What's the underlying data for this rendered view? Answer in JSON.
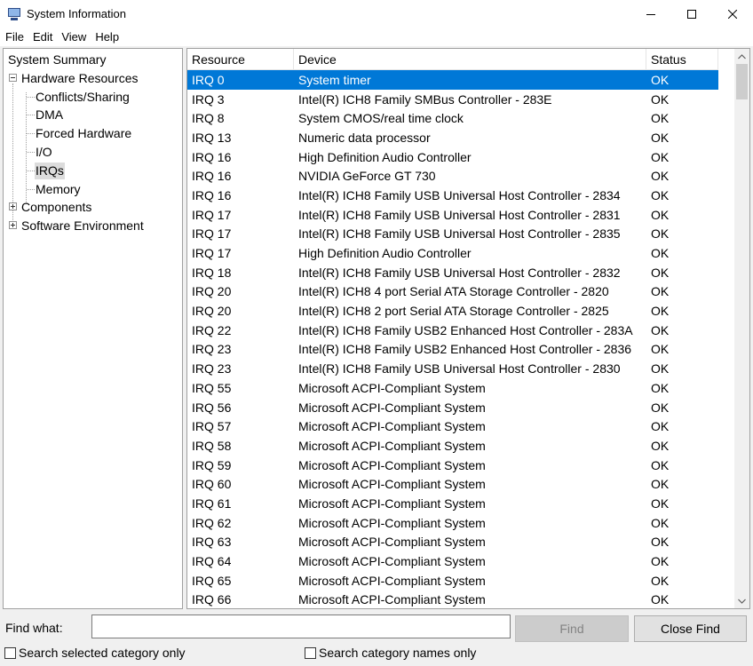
{
  "window": {
    "title": "System Information"
  },
  "menu": [
    "File",
    "Edit",
    "View",
    "Help"
  ],
  "tree": {
    "summary": "System Summary",
    "hardware": "Hardware Resources",
    "hardware_children": [
      "Conflicts/Sharing",
      "DMA",
      "Forced Hardware",
      "I/O",
      "IRQs",
      "Memory"
    ],
    "components": "Components",
    "software": "Software Environment",
    "selected": "IRQs"
  },
  "table": {
    "columns": [
      "Resource",
      "Device",
      "Status"
    ],
    "rows": [
      [
        "IRQ 0",
        "System timer",
        "OK"
      ],
      [
        "IRQ 3",
        "Intel(R) ICH8 Family SMBus Controller - 283E",
        "OK"
      ],
      [
        "IRQ 8",
        "System CMOS/real time clock",
        "OK"
      ],
      [
        "IRQ 13",
        "Numeric data processor",
        "OK"
      ],
      [
        "IRQ 16",
        "High Definition Audio Controller",
        "OK"
      ],
      [
        "IRQ 16",
        "NVIDIA GeForce GT 730",
        "OK"
      ],
      [
        "IRQ 16",
        "Intel(R) ICH8 Family USB Universal Host Controller - 2834",
        "OK"
      ],
      [
        "IRQ 17",
        "Intel(R) ICH8 Family USB Universal Host Controller - 2831",
        "OK"
      ],
      [
        "IRQ 17",
        "Intel(R) ICH8 Family USB Universal Host Controller - 2835",
        "OK"
      ],
      [
        "IRQ 17",
        "High Definition Audio Controller",
        "OK"
      ],
      [
        "IRQ 18",
        "Intel(R) ICH8 Family USB Universal Host Controller - 2832",
        "OK"
      ],
      [
        "IRQ 20",
        "Intel(R) ICH8 4 port Serial ATA Storage Controller - 2820",
        "OK"
      ],
      [
        "IRQ 20",
        "Intel(R) ICH8 2 port Serial ATA Storage Controller - 2825",
        "OK"
      ],
      [
        "IRQ 22",
        "Intel(R) ICH8 Family USB2 Enhanced Host Controller - 283A",
        "OK"
      ],
      [
        "IRQ 23",
        "Intel(R) ICH8 Family USB2 Enhanced Host Controller - 2836",
        "OK"
      ],
      [
        "IRQ 23",
        "Intel(R) ICH8 Family USB Universal Host Controller - 2830",
        "OK"
      ],
      [
        "IRQ 55",
        "Microsoft ACPI-Compliant System",
        "OK"
      ],
      [
        "IRQ 56",
        "Microsoft ACPI-Compliant System",
        "OK"
      ],
      [
        "IRQ 57",
        "Microsoft ACPI-Compliant System",
        "OK"
      ],
      [
        "IRQ 58",
        "Microsoft ACPI-Compliant System",
        "OK"
      ],
      [
        "IRQ 59",
        "Microsoft ACPI-Compliant System",
        "OK"
      ],
      [
        "IRQ 60",
        "Microsoft ACPI-Compliant System",
        "OK"
      ],
      [
        "IRQ 61",
        "Microsoft ACPI-Compliant System",
        "OK"
      ],
      [
        "IRQ 62",
        "Microsoft ACPI-Compliant System",
        "OK"
      ],
      [
        "IRQ 63",
        "Microsoft ACPI-Compliant System",
        "OK"
      ],
      [
        "IRQ 64",
        "Microsoft ACPI-Compliant System",
        "OK"
      ],
      [
        "IRQ 65",
        "Microsoft ACPI-Compliant System",
        "OK"
      ],
      [
        "IRQ 66",
        "Microsoft ACPI-Compliant System",
        "OK"
      ]
    ],
    "selected_row": 0
  },
  "find": {
    "label": "Find what:",
    "value": "",
    "find_button": "Find",
    "close_button": "Close Find",
    "search_selected": "Search selected category only",
    "search_names": "Search category names only"
  },
  "colors": {
    "selection": "#0078d7",
    "tree_selection": "#dcdcdc"
  }
}
